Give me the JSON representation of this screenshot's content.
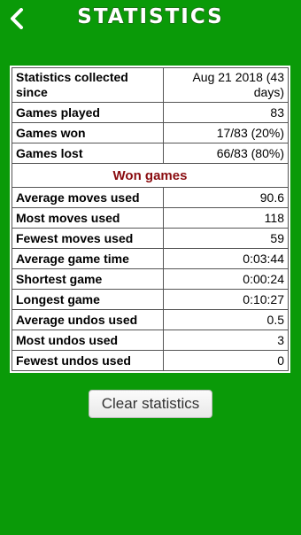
{
  "header": {
    "title": "STATISTICS",
    "back_icon": "chevron-left-icon"
  },
  "stats": {
    "general": [
      {
        "label": "Statistics collected since",
        "value": "Aug 21 2018 (43 days)"
      },
      {
        "label": "Games played",
        "value": "83"
      },
      {
        "label": "Games won",
        "value": "17/83 (20%)"
      },
      {
        "label": "Games lost",
        "value": "66/83 (80%)"
      }
    ],
    "section_title": "Won games",
    "won": [
      {
        "label": "Average moves used",
        "value": "90.6"
      },
      {
        "label": "Most moves used",
        "value": "118"
      },
      {
        "label": "Fewest moves used",
        "value": "59"
      },
      {
        "label": "Average game time",
        "value": "0:03:44"
      },
      {
        "label": "Shortest game",
        "value": "0:00:24"
      },
      {
        "label": "Longest game",
        "value": "0:10:27"
      },
      {
        "label": "Average undos used",
        "value": "0.5"
      },
      {
        "label": "Most undos used",
        "value": "3"
      },
      {
        "label": "Fewest undos used",
        "value": "0"
      }
    ]
  },
  "actions": {
    "clear_label": "Clear statistics"
  },
  "colors": {
    "background": "#0a9a08",
    "section_title": "#8a0c10"
  }
}
